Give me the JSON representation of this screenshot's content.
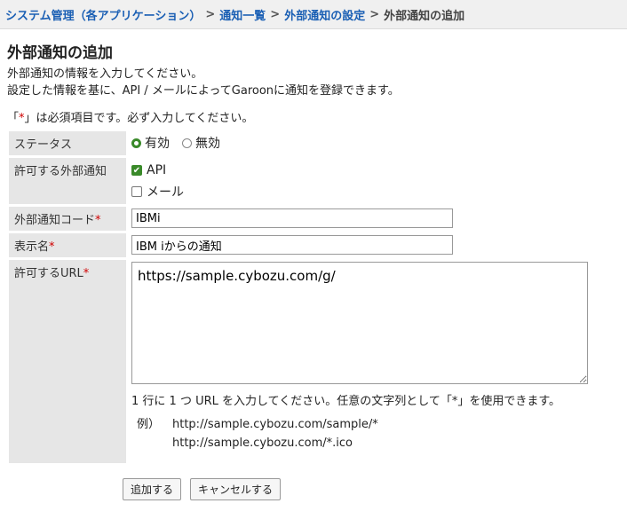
{
  "breadcrumb": {
    "items": [
      "システム管理（各アプリケーション）",
      "通知一覧",
      "外部通知の設定"
    ],
    "current": "外部通知の追加",
    "separator": ">"
  },
  "page": {
    "title": "外部通知の追加",
    "desc_line1": "外部通知の情報を入力してください。",
    "desc_line2": "設定した情報を基に、API / メールによってGaroonに通知を登録できます。",
    "required_note_prefix": "「",
    "required_mark": "*",
    "required_note_suffix": "」は必須項目です。必ず入力してください。"
  },
  "form": {
    "status": {
      "label": "ステータス",
      "options": [
        "有効",
        "無効"
      ],
      "selected": "有効"
    },
    "allowed": {
      "label": "許可する外部通知",
      "options": [
        {
          "label": "API",
          "checked": true
        },
        {
          "label": "メール",
          "checked": false
        }
      ]
    },
    "code": {
      "label": "外部通知コード",
      "value": "IBMi"
    },
    "display_name": {
      "label": "表示名",
      "value": "IBM iからの通知"
    },
    "url": {
      "label": "許可するURL",
      "value": "https://sample.cybozu.com/g/",
      "hint": "1 行に 1 つ URL を入力してください。任意の文字列として「*」を使用できます。",
      "example_label": "例）",
      "examples": [
        "http://sample.cybozu.com/sample/*",
        "http://sample.cybozu.com/*.ico"
      ]
    },
    "required_mark": "*"
  },
  "buttons": {
    "add": "追加する",
    "cancel": "キャンセルする"
  },
  "colors": {
    "link": "#1a5fb4",
    "required": "#d00000",
    "check": "#3a8a2a"
  }
}
